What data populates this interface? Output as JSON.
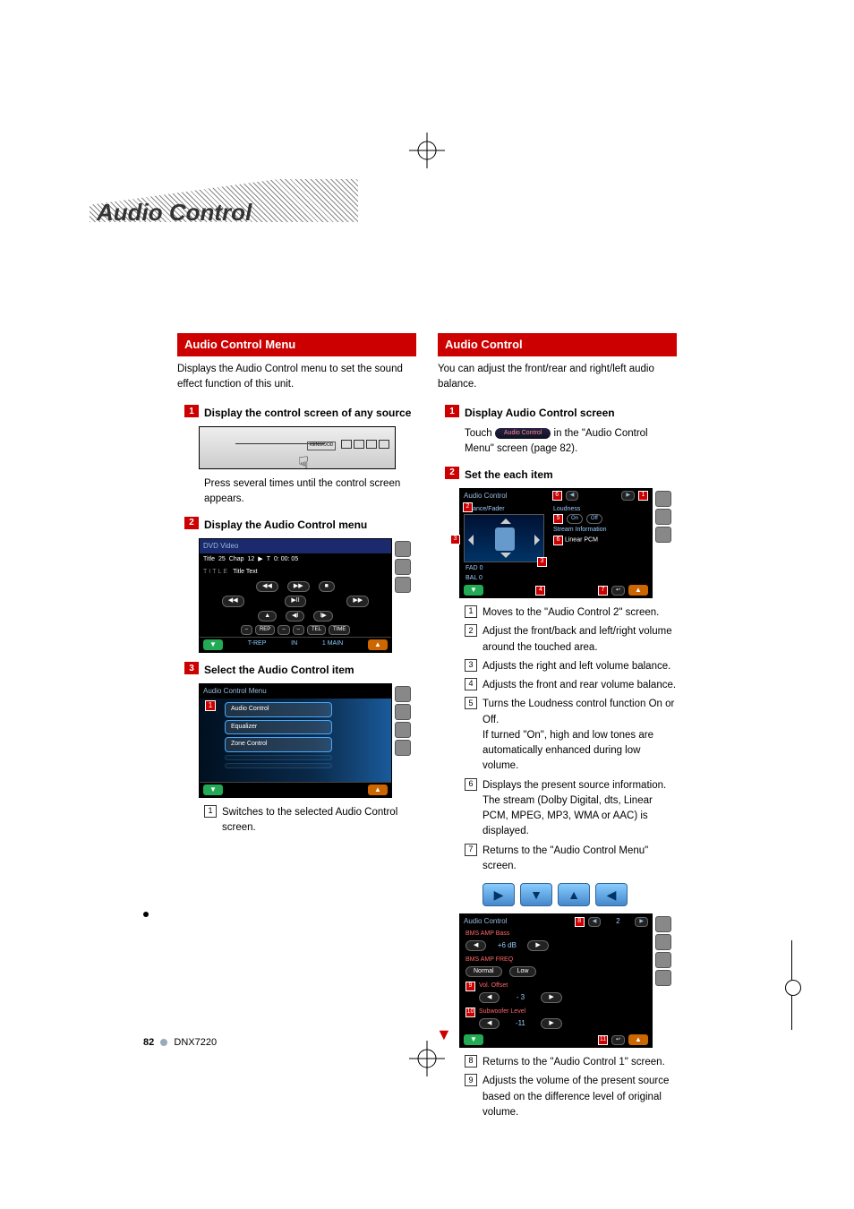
{
  "page_title": "Audio Control",
  "left": {
    "section_title": "Audio Control Menu",
    "intro": "Displays the Audio Control menu to set the sound effect function of this unit.",
    "step1_label": "Display the control screen of any source",
    "device_brand": "KENWOOD",
    "step1_note": "Press several times until the control screen appears.",
    "step2_label": "Display the Audio Control menu",
    "dvd": {
      "header": "DVD Video",
      "title_label": "Title",
      "title_val": "25",
      "chap_label": "Chap",
      "chap_val": "12",
      "play_sym": "▶",
      "t_label": "T",
      "time": "0: 00: 05",
      "title_text_label": "TITLE",
      "title_text": "Title Text",
      "btn_prev": "◀◀",
      "btn_playpause": "▶II",
      "btn_next": "▶▶",
      "btn_stop": "■",
      "btn_eject": "▲",
      "btn_back": "◀I",
      "btn_fwd": "I▶",
      "row_btns": [
        "–",
        "REP",
        "–",
        "–",
        "TEL",
        "TIME"
      ],
      "foot_left": "T-REP",
      "foot_mid": "IN",
      "foot_right": "1 MAIN"
    },
    "step3_label": "Select the Audio Control item",
    "menu": {
      "header": "Audio Control Menu",
      "callout": "1",
      "items": [
        "Audio Control",
        "Equalizer",
        "Zone Control"
      ]
    },
    "ns1": "Switches to the selected Audio Control screen."
  },
  "right": {
    "section_title": "Audio Control",
    "intro": "You can adjust the front/rear and right/left audio balance.",
    "step1_label": "Display Audio Control screen",
    "touch_prefix": "Touch",
    "touch_btn": "Audio Control",
    "touch_suffix": " in the \"Audio Control Menu\" screen (page 82).",
    "step2_label": "Set the each item",
    "ac1": {
      "header": "Audio Control",
      "bf": "Balance/Fader",
      "loud": "Loudness",
      "on": "On",
      "off": "Off",
      "stream_label": "Stream Information",
      "stream_val": "Linear PCM",
      "fad_label": "FAD",
      "fad_val": "0",
      "bal_label": "BAL",
      "bal_val": "0",
      "c1": "1",
      "c2": "2",
      "c3": "3",
      "c4": "4",
      "c5": "5",
      "c6": "6",
      "c7": "7"
    },
    "notes": {
      "n1": "Moves to the \"Audio Control 2\" screen.",
      "n2": "Adjust the front/back and left/right volume around the touched area.",
      "n3": "Adjusts the right and left volume balance.",
      "n4": "Adjusts the front and rear volume balance.",
      "n5": "Turns the Loudness control function On or Off.",
      "n5b": "If turned \"On\", high and low tones are automatically enhanced during low volume.",
      "n6": "Displays the present source information. The stream (Dolby Digital, dts, Linear PCM, MPEG, MP3, WMA or AAC) is displayed.",
      "n7": "Returns to the \"Audio Control Menu\" screen."
    },
    "ac2": {
      "header": "Audio Control",
      "row1_label": "BMS AMP Bass",
      "row1_val": "+6 dB",
      "row2_label": "BMS AMP FREQ",
      "row2_a": "Normal",
      "row2_b": "Low",
      "row3_label": "Vol. Offset",
      "row3_val": "- 3",
      "row4_label": "Subwoofer Level",
      "row4_val": "-11",
      "c8": "8",
      "c9": "9",
      "c10": "10",
      "c11": "11",
      "c2top": "2"
    },
    "notes2": {
      "n8": "Returns to the \"Audio Control 1\" screen.",
      "n9": "Adjusts the volume of the present source based on the difference level of original volume."
    }
  },
  "footer": {
    "page": "82",
    "model": "DNX7220"
  }
}
